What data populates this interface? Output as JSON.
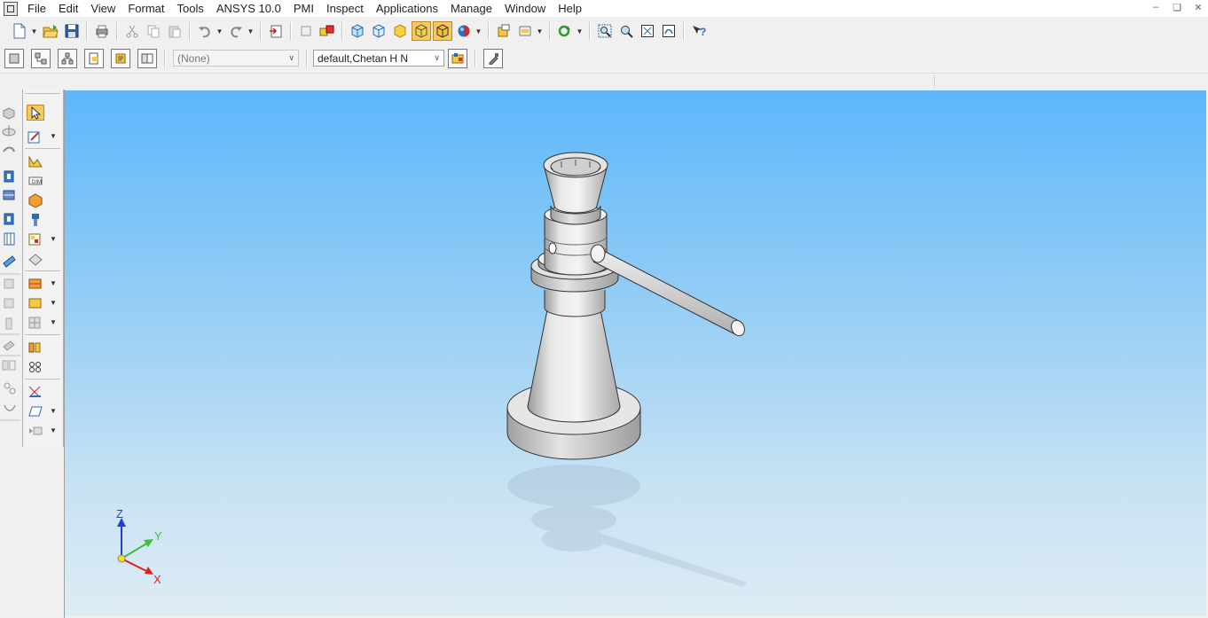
{
  "menu": [
    "File",
    "Edit",
    "View",
    "Format",
    "Tools",
    "ANSYS 10.0",
    "PMI",
    "Inspect",
    "Applications",
    "Manage",
    "Window",
    "Help"
  ],
  "toolbar2": {
    "layer_combo": "(None)",
    "config_combo": "default,Chetan H N"
  },
  "triad": {
    "z": "Z",
    "y": "Y",
    "x": "X"
  },
  "colors": {
    "viewport_top": "#5db7fb",
    "viewport_bottom": "#deecf5",
    "active_button": "#f8c860"
  },
  "icons": {
    "toolbar1": [
      "new-file-icon",
      "open-folder-icon",
      "save-icon",
      "print-icon",
      "cut-icon",
      "copy-icon",
      "paste-icon",
      "undo-icon",
      "redo-icon",
      "insert-part-icon",
      "component-icon",
      "multi-component-icon",
      "iso-view-icon",
      "front-view-icon",
      "shaded-icon",
      "shaded-edges-icon",
      "shaded-active-icon",
      "appearance-icon",
      "property-manager-icon",
      "display-style-icon",
      "rebuild-icon",
      "zoom-window-icon",
      "zoom-icon",
      "zoom-fit-icon",
      "pan-icon",
      "help-icon"
    ],
    "toolbar2": [
      "part-tree-icon",
      "assembly-tree-icon",
      "hierarchy-icon",
      "property-icon",
      "notes-icon",
      "compare-icon",
      "layer-manager-icon",
      "edit-config-icon"
    ],
    "left_col1": [
      "sketch-feature-icon",
      "revolve-feature-icon",
      "sweep-feature-icon",
      "extrude-feature-icon",
      "loft-feature-icon",
      "cut-extrude-icon",
      "hole-feature-icon",
      "plane-feature-icon",
      "fillet-feature-icon",
      "chamfer-feature-icon",
      "shell-feature-icon",
      "draft-feature-icon",
      "pattern-feature-icon",
      "mirror-feature-icon",
      "rib-feature-icon"
    ],
    "left_col2": [
      "select-arrow-icon",
      "sketch-tool-icon",
      "sketch-entity-icon",
      "dimension-icon",
      "insert-component-icon",
      "mate-icon",
      "move-component-icon",
      "assembly-feature-icon",
      "reference-geometry-icon",
      "explode-icon",
      "section-view-icon",
      "measure-icon",
      "interference-icon",
      "smart-fastener-icon",
      "coordinate-icon",
      "plane-icon",
      "sensor-icon"
    ]
  }
}
